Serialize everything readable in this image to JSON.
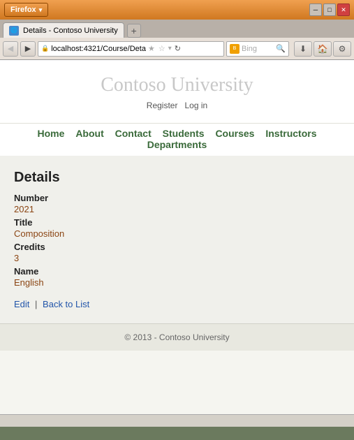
{
  "browser": {
    "firefox_label": "Firefox",
    "tab_title": "Details - Contoso University",
    "address": "localhost:4321/Course/Deta",
    "new_tab_label": "+",
    "search_placeholder": "Bing",
    "nav_back": "◀",
    "nav_forward": "▶",
    "minimize": "─",
    "maximize": "□",
    "close": "✕"
  },
  "site": {
    "title": "Contoso University",
    "auth_register": "Register",
    "auth_login": "Log in",
    "nav_items": [
      "Home",
      "About",
      "Contact",
      "Students",
      "Courses",
      "Instructors",
      "Departments"
    ],
    "footer": "© 2013 - Contoso University"
  },
  "details": {
    "heading": "Details",
    "fields": [
      {
        "label": "Number",
        "value": "2021"
      },
      {
        "label": "Title",
        "value": "Composition"
      },
      {
        "label": "Credits",
        "value": "3"
      },
      {
        "label": "Name",
        "value": "English"
      }
    ],
    "edit_label": "Edit",
    "back_label": "Back to List"
  }
}
